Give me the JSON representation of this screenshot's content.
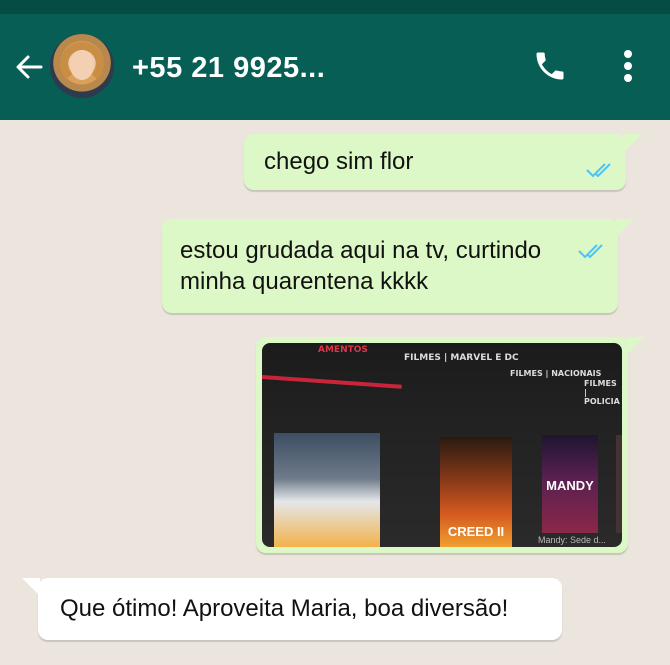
{
  "header": {
    "contact_name": "+55 21 9925..."
  },
  "messages": [
    {
      "id": 1,
      "direction": "outgoing",
      "text": "chego sim flor",
      "status": "read"
    },
    {
      "id": 2,
      "direction": "outgoing",
      "text": "estou grudada aqui na tv, curtindo minha quarentena kkkk",
      "status": "read"
    },
    {
      "id": 3,
      "direction": "outgoing",
      "type": "image",
      "image_text": {
        "tab_red": "AMENTOS",
        "tab_1": "FILMES | MARVEL E DC",
        "tab_2": "FILMES | NACIONAIS",
        "tab_3": "FILMES | POLICIA",
        "poster_2_title": "CREED II",
        "poster_3_title": "MANDY",
        "poster_3_caption": "Mandy: Sede d..."
      }
    },
    {
      "id": 4,
      "direction": "incoming",
      "text": "Que ótimo! Aproveita Maria, boa diversão!"
    }
  ],
  "colors": {
    "header_bg": "#075e54",
    "chat_bg": "#ece5dd",
    "outgoing_bubble": "#dcf8c6",
    "incoming_bubble": "#ffffff",
    "read_ticks": "#4fc3f7"
  },
  "icons": {
    "back": "arrow-left-icon",
    "call": "phone-icon",
    "menu": "more-vertical-icon",
    "status": "double-check-icon"
  }
}
